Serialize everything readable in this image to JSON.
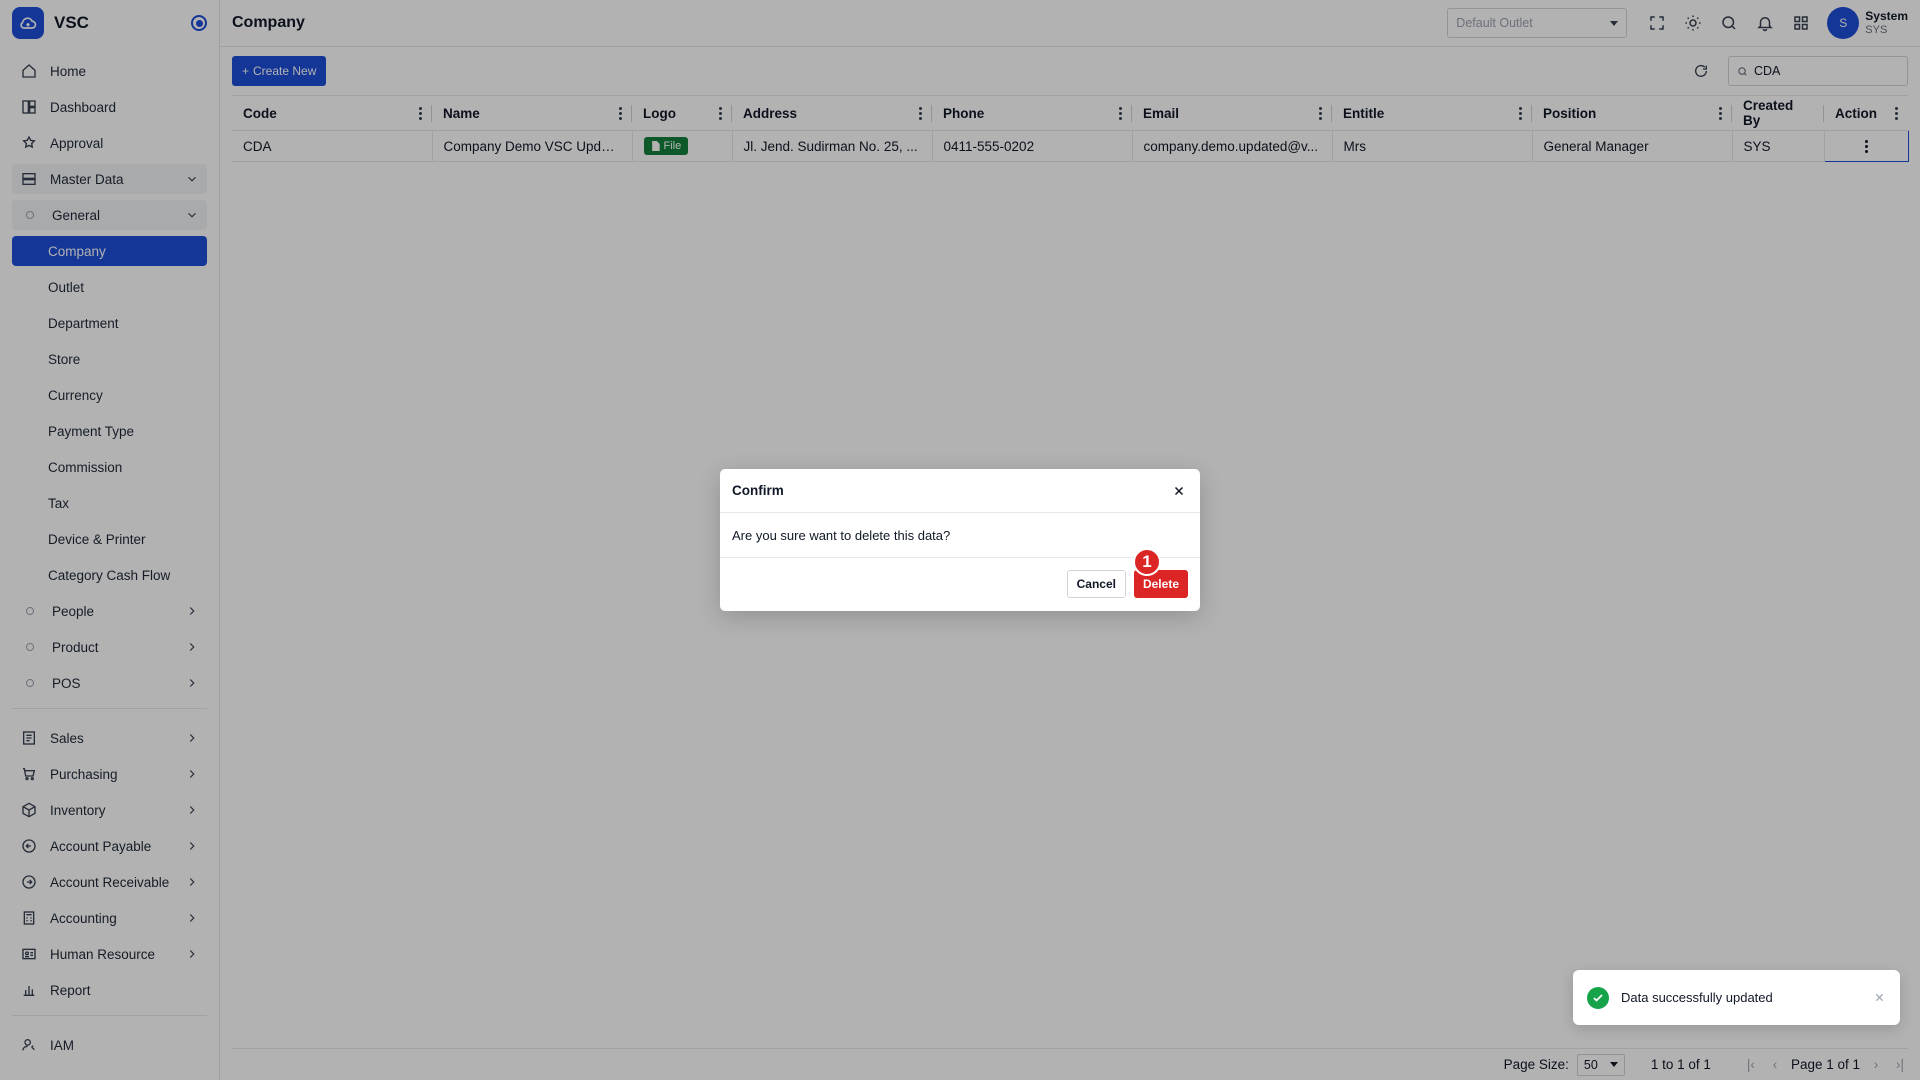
{
  "app": {
    "name": "VSC"
  },
  "header": {
    "title": "Company",
    "outlet_placeholder": "Default Outlet",
    "user": {
      "initial": "S",
      "name": "System",
      "code": "SYS"
    }
  },
  "sidebar": {
    "top_items": [
      {
        "label": "Home",
        "icon": "home-icon"
      },
      {
        "label": "Dashboard",
        "icon": "dashboard-icon"
      },
      {
        "label": "Approval",
        "icon": "approval-icon"
      }
    ],
    "master_data": {
      "label": "Master Data",
      "icon": "database-icon"
    },
    "general": {
      "label": "General"
    },
    "general_items": [
      "Company",
      "Outlet",
      "Department",
      "Store",
      "Currency",
      "Payment Type",
      "Commission",
      "Tax",
      "Device & Printer",
      "Category Cash Flow"
    ],
    "groups": [
      "People",
      "Product",
      "POS"
    ],
    "modules": [
      {
        "label": "Sales",
        "icon": "sales-icon"
      },
      {
        "label": "Purchasing",
        "icon": "cart-icon"
      },
      {
        "label": "Inventory",
        "icon": "box-icon"
      },
      {
        "label": "Account Payable",
        "icon": "payable-icon"
      },
      {
        "label": "Account Receivable",
        "icon": "receivable-icon"
      },
      {
        "label": "Accounting",
        "icon": "calculator-icon"
      },
      {
        "label": "Human Resource",
        "icon": "id-card-icon"
      },
      {
        "label": "Report",
        "icon": "bar-chart-icon"
      }
    ],
    "iam": {
      "label": "IAM",
      "icon": "user-key-icon"
    }
  },
  "toolbar": {
    "create_label": "Create New",
    "search_value": "CDA"
  },
  "table": {
    "columns": [
      "Code",
      "Name",
      "Logo",
      "Address",
      "Phone",
      "Email",
      "Entitle",
      "Position",
      "Created By",
      "Action"
    ],
    "rows": [
      {
        "code": "CDA",
        "name": "Company Demo VSC Updat...",
        "logo": "File",
        "address": "Jl. Jend. Sudirman No. 25, ...",
        "phone": "0411-555-0202",
        "email": "company.demo.updated@v...",
        "entitle": "Mrs",
        "position": "General Manager",
        "created_by": "SYS"
      }
    ]
  },
  "pager": {
    "page_size_label": "Page Size:",
    "page_size": "50",
    "range": "1 to 1 of 1",
    "page_text": "Page 1 of 1"
  },
  "dialog": {
    "title": "Confirm",
    "message": "Are you sure want to delete this data?",
    "cancel_label": "Cancel",
    "delete_label": "Delete",
    "marker": "1"
  },
  "toast": {
    "message": "Data successfully updated"
  },
  "colors": {
    "primary": "#1d4ed8",
    "danger": "#dc2626",
    "success": "#16a34a"
  }
}
